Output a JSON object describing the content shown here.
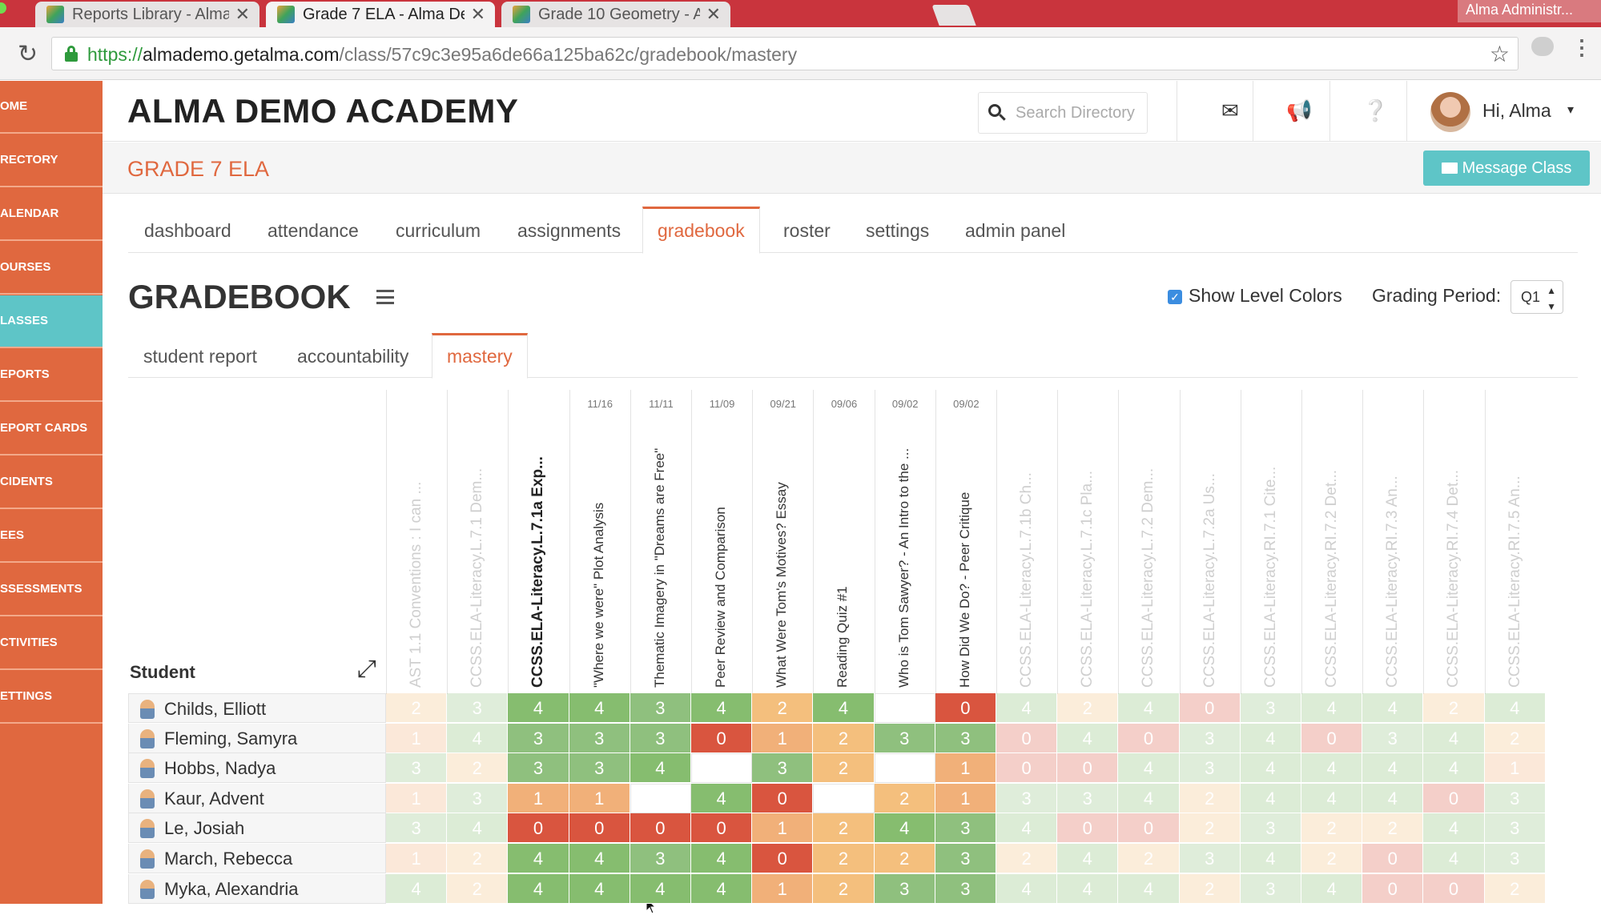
{
  "browser": {
    "tabs": [
      {
        "label": "Reports Library - Alma Demo A",
        "active": false
      },
      {
        "label": "Grade 7 ELA - Alma Demo Aca",
        "active": true
      },
      {
        "label": "Grade 10 Geometry - Alma De",
        "active": false
      }
    ],
    "profile": "Alma Administr...",
    "url_scheme": "https://",
    "url_host": "almademo.getalma.com",
    "url_path": "/class/57c9c3e95a6de66a125ba62c/gradebook/mastery"
  },
  "sidebar": {
    "items": [
      {
        "label": "OME"
      },
      {
        "label": "RECTORY"
      },
      {
        "label": "ALENDAR"
      },
      {
        "label": "OURSES"
      },
      {
        "label": "LASSES",
        "active": true
      },
      {
        "label": "EPORTS"
      },
      {
        "label": "EPORT CARDS"
      },
      {
        "label": "CIDENTS"
      },
      {
        "label": "EES"
      },
      {
        "label": "SSESSMENTS"
      },
      {
        "label": "CTIVITIES"
      },
      {
        "label": "ETTINGS"
      }
    ]
  },
  "header": {
    "school_name": "ALMA DEMO ACADEMY",
    "search_placeholder": "Search Directory",
    "greeting": "Hi, Alma"
  },
  "class": {
    "name": "GRADE 7 ELA",
    "message_button": "Message Class"
  },
  "main_tabs": [
    "dashboard",
    "attendance",
    "curriculum",
    "assignments",
    "gradebook",
    "roster",
    "settings",
    "admin panel"
  ],
  "gradebook": {
    "title": "GRADEBOOK",
    "show_level_colors_label": "Show Level Colors",
    "show_level_colors": true,
    "grading_period_label": "Grading Period:",
    "grading_period": "Q1",
    "sub_tabs": [
      "student report",
      "accountability",
      "mastery"
    ],
    "student_header": "Student"
  },
  "level_colors": {
    "0": "#d9553f",
    "1": "#f1b079",
    "2": "#f4bf7d",
    "3": "#8fc07e",
    "4": "#86bd6f",
    "empty": "#ffffff",
    "faded_empty": "#eeeeee"
  },
  "columns": [
    {
      "date": "",
      "label": "AST 1.1 Conventions : I can ...",
      "style": "faded"
    },
    {
      "date": "",
      "label": "CCSS.ELA-Literacy.L.7.1 Dem...",
      "style": "faded"
    },
    {
      "date": "",
      "label": "CCSS.ELA-Literacy.L.7.1a Exp...",
      "style": "bold"
    },
    {
      "date": "11/16",
      "label": "\"Where we were\" Plot Analysis",
      "style": "normal"
    },
    {
      "date": "11/11",
      "label": "Thematic Imagery in \"Dreams are Free\"",
      "style": "normal"
    },
    {
      "date": "11/09",
      "label": "Peer Review and Comparison",
      "style": "normal"
    },
    {
      "date": "09/21",
      "label": "What Were Tom's Motives? Essay",
      "style": "normal"
    },
    {
      "date": "09/06",
      "label": "Reading Quiz #1",
      "style": "normal"
    },
    {
      "date": "09/02",
      "label": "Who is Tom Sawyer? - An Intro to the ...",
      "style": "normal"
    },
    {
      "date": "09/02",
      "label": "How Did We Do? - Peer Critique",
      "style": "normal"
    },
    {
      "date": "",
      "label": "CCSS.ELA-Literacy.L.7.1b Ch...",
      "style": "faded"
    },
    {
      "date": "",
      "label": "CCSS.ELA-Literacy.L.7.1c Pla...",
      "style": "faded"
    },
    {
      "date": "",
      "label": "CCSS.ELA-Literacy.L.7.2 Dem...",
      "style": "faded"
    },
    {
      "date": "",
      "label": "CCSS.ELA-Literacy.L.7.2a Us...",
      "style": "faded"
    },
    {
      "date": "",
      "label": "CCSS.ELA-Literacy.RI.7.1 Cite...",
      "style": "faded"
    },
    {
      "date": "",
      "label": "CCSS.ELA-Literacy.RI.7.2 Det...",
      "style": "faded"
    },
    {
      "date": "",
      "label": "CCSS.ELA-Literacy.RI.7.3 An...",
      "style": "faded"
    },
    {
      "date": "",
      "label": "CCSS.ELA-Literacy.RI.7.4 Det...",
      "style": "faded"
    },
    {
      "date": "",
      "label": "CCSS.ELA-Literacy.RI.7.5 An...",
      "style": "faded"
    }
  ],
  "students": [
    {
      "name": "Childs, Elliott",
      "scores": [
        "2",
        "3",
        "4",
        "4",
        "3",
        "4",
        "2",
        "4",
        "",
        "0",
        "4",
        "2",
        "4",
        "0",
        "3",
        "4",
        "4",
        "2",
        "4"
      ]
    },
    {
      "name": "Fleming, Samyra",
      "scores": [
        "1",
        "4",
        "3",
        "3",
        "3",
        "0",
        "1",
        "2",
        "3",
        "3",
        "0",
        "4",
        "0",
        "3",
        "4",
        "0",
        "3",
        "4",
        "2"
      ]
    },
    {
      "name": "Hobbs, Nadya",
      "scores": [
        "3",
        "2",
        "3",
        "3",
        "4",
        "",
        "3",
        "2",
        "",
        "1",
        "0",
        "0",
        "4",
        "3",
        "4",
        "4",
        "4",
        "4",
        "1"
      ]
    },
    {
      "name": "Kaur, Advent",
      "scores": [
        "1",
        "3",
        "1",
        "1",
        "",
        "4",
        "0",
        "",
        "2",
        "1",
        "3",
        "3",
        "4",
        "2",
        "4",
        "4",
        "4",
        "0",
        "3"
      ]
    },
    {
      "name": "Le, Josiah",
      "scores": [
        "3",
        "4",
        "0",
        "0",
        "0",
        "0",
        "1",
        "2",
        "4",
        "3",
        "4",
        "0",
        "0",
        "2",
        "3",
        "2",
        "2",
        "4",
        "3"
      ]
    },
    {
      "name": "March, Rebecca",
      "scores": [
        "1",
        "2",
        "4",
        "4",
        "3",
        "4",
        "0",
        "2",
        "2",
        "3",
        "2",
        "4",
        "2",
        "3",
        "4",
        "2",
        "0",
        "4",
        "3"
      ]
    },
    {
      "name": "Myka, Alexandria",
      "scores": [
        "4",
        "2",
        "4",
        "4",
        "4",
        "4",
        "1",
        "2",
        "3",
        "3",
        "4",
        "4",
        "4",
        "2",
        "3",
        "4",
        "0",
        "0",
        "2"
      ]
    }
  ]
}
